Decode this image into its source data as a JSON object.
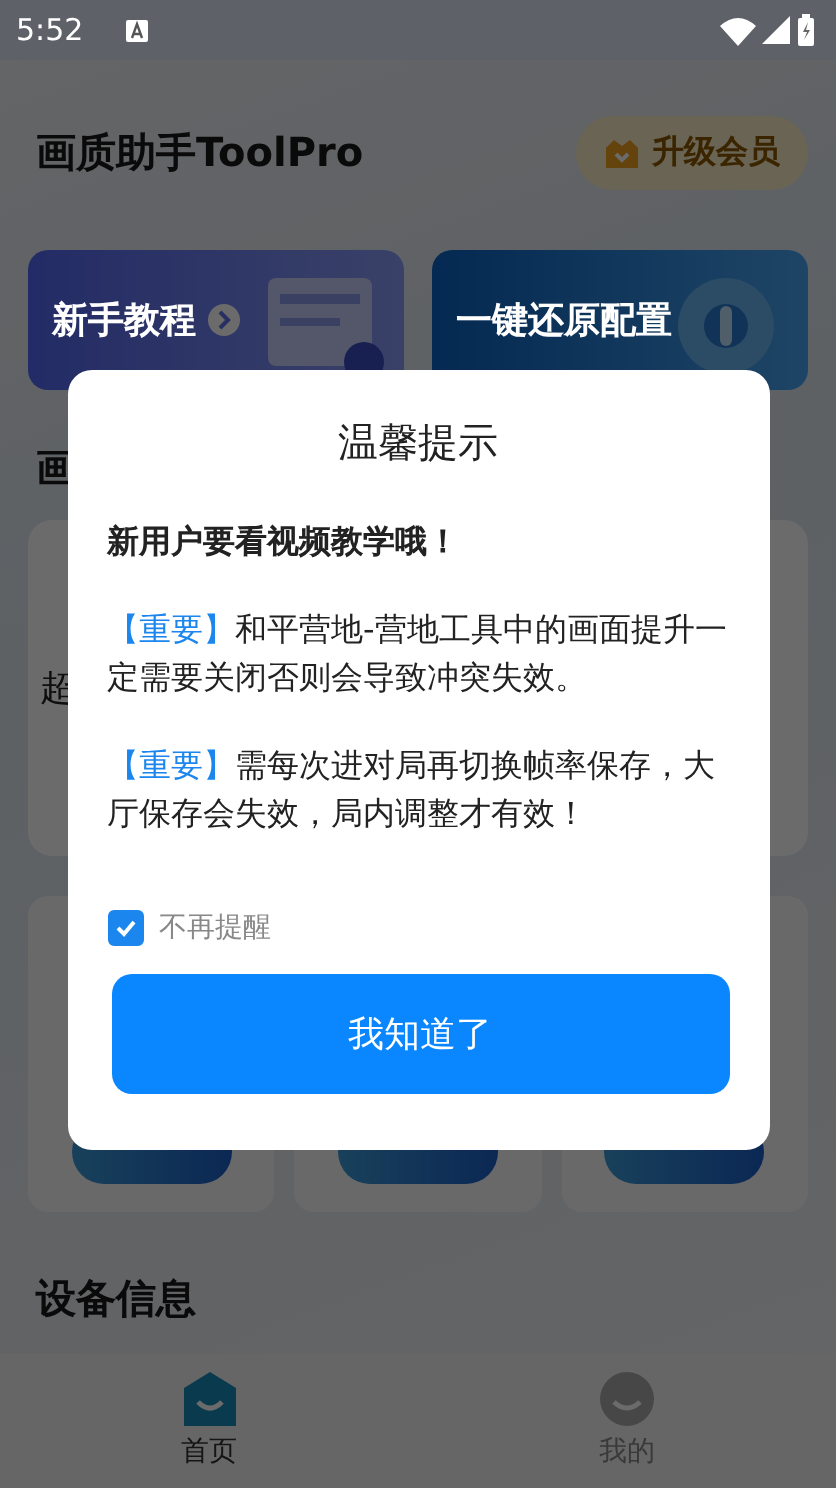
{
  "status_bar": {
    "time": "5:52"
  },
  "header": {
    "title": "画质助手ToolPro",
    "upgrade_button": "升级会员"
  },
  "feature_cards": [
    {
      "label": "新手教程",
      "kind": "tutorial"
    },
    {
      "label": "一键还原配置",
      "kind": "restore"
    }
  ],
  "section_title": "画",
  "panel": {
    "label": "超"
  },
  "device_section": {
    "title": "设备信息"
  },
  "bottom_nav": [
    {
      "label": "首页",
      "selected": true
    },
    {
      "label": "我的",
      "selected": false
    }
  ],
  "dialog": {
    "title": "温馨提示",
    "intro": "新用户要看视频教学哦！",
    "notes": [
      {
        "tag": "【重要】",
        "text": "和平营地-营地工具中的画面提升一定需要关闭否则会导致冲突失效。"
      },
      {
        "tag": "【重要】",
        "text": "需每次进对局再切换帧率保存，大厅保存会失效，局内调整才有效！"
      }
    ],
    "dont_remind": {
      "label": "不再提醒",
      "checked": true
    },
    "confirm_button": "我知道了"
  }
}
